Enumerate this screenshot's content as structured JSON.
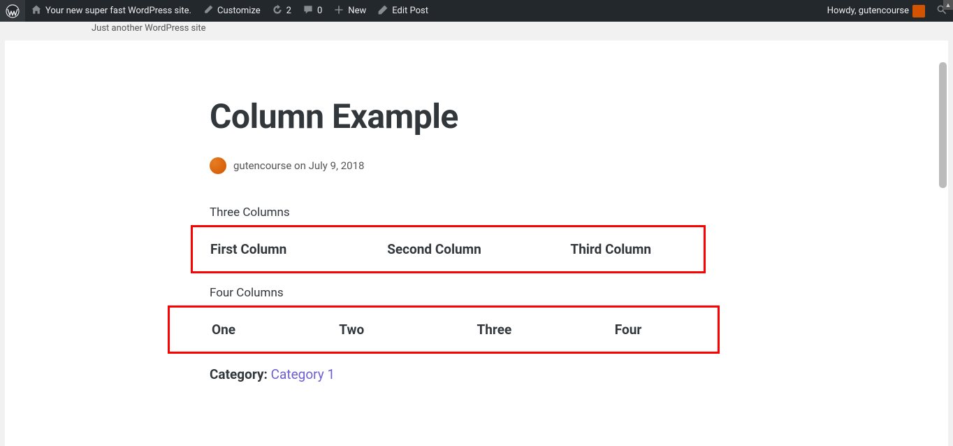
{
  "adminbar": {
    "site_name": "Your new super fast WordPress site.",
    "customize": "Customize",
    "updates": "2",
    "comments": "0",
    "new": "New",
    "edit_post": "Edit Post",
    "howdy": "Howdy, gutencourse"
  },
  "tagline": "Just another WordPress site",
  "post": {
    "title": "Column Example",
    "author": "gutencourse",
    "on": "on",
    "date": "July 9, 2018"
  },
  "sections": {
    "three_label": "Three Columns",
    "three_cols": [
      "First Column",
      "Second Column",
      "Third Column"
    ],
    "four_label": "Four Columns",
    "four_cols": [
      "One",
      "Two",
      "Three",
      "Four"
    ]
  },
  "category": {
    "label": "Category:",
    "link": "Category 1"
  }
}
